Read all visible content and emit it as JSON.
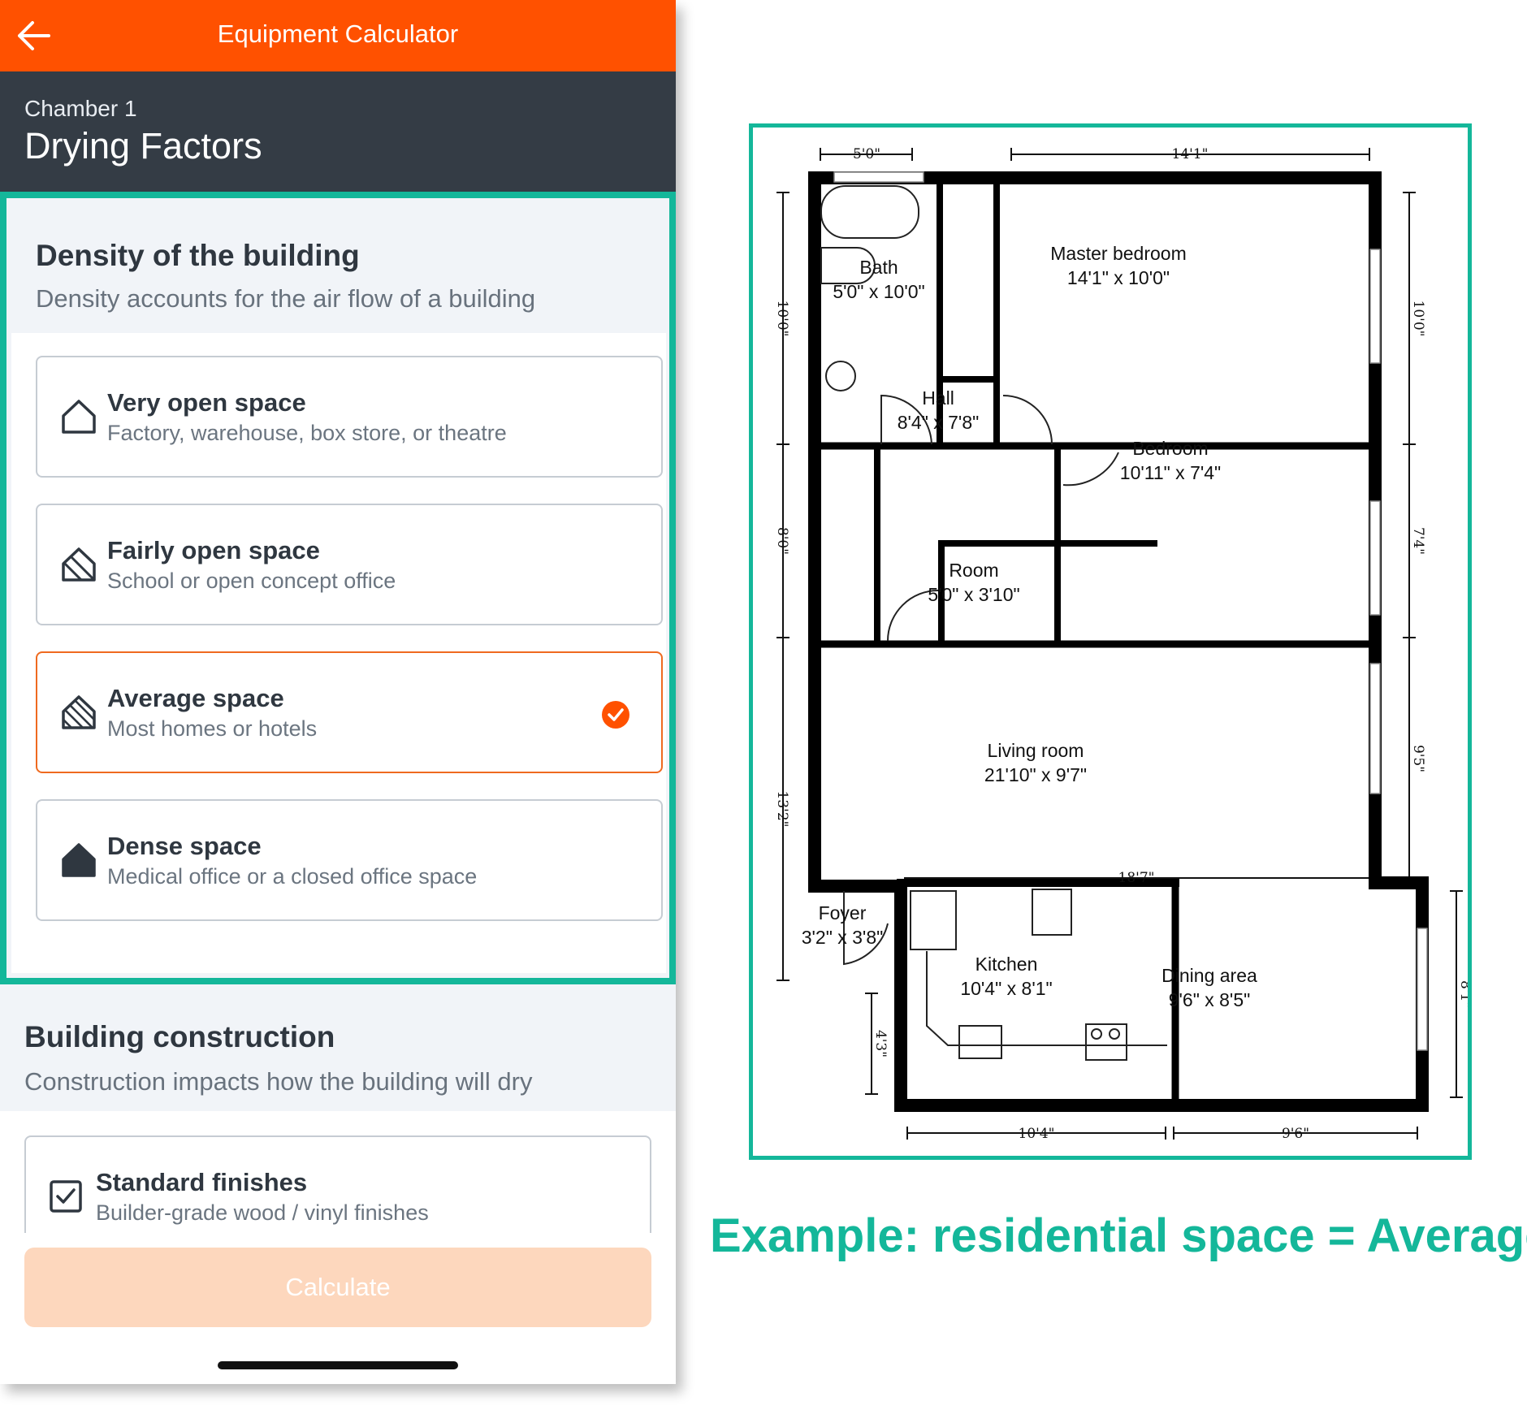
{
  "app": {
    "title": "Equipment Calculator"
  },
  "header": {
    "chamber": "Chamber 1",
    "page_title": "Drying Factors"
  },
  "density": {
    "title": "Density of the building",
    "subtitle": "Density accounts for the air flow of a building",
    "options": [
      {
        "title": "Very open space",
        "subtitle": "Factory, warehouse, box store, or theatre",
        "icon": "house-outline-icon",
        "selected": false
      },
      {
        "title": "Fairly open space",
        "subtitle": "School or open concept office",
        "icon": "house-light-hatch-icon",
        "selected": false
      },
      {
        "title": "Average space",
        "subtitle": "Most homes or hotels",
        "icon": "house-dense-hatch-icon",
        "selected": true
      },
      {
        "title": "Dense space",
        "subtitle": "Medical office or a closed office space",
        "icon": "house-filled-icon",
        "selected": false
      }
    ]
  },
  "construction": {
    "title": "Building construction",
    "subtitle": "Construction impacts how the building will dry",
    "options": [
      {
        "title": "Standard finishes",
        "subtitle": "Builder-grade wood / vinyl finishes",
        "icon": "checkbox-icon"
      }
    ]
  },
  "calculate_button": {
    "label": "Calculate"
  },
  "colors": {
    "accent": "#ff5100",
    "header": "#343c45",
    "highlight": "#14b79a",
    "selected_border": "#ef6a1f",
    "button_disabled": "#fdd7bd"
  },
  "floorplan": {
    "rooms": [
      {
        "name": "Master bedroom",
        "size": "14'1\" x 10'0\""
      },
      {
        "name": "Bath",
        "size": "5'0\" x 10'0\""
      },
      {
        "name": "Hall",
        "size": "8'4\" x 7'8\""
      },
      {
        "name": "Bedroom",
        "size": "10'11\" x 7'4\""
      },
      {
        "name": "Room",
        "size": "5'0\" x 3'10\""
      },
      {
        "name": "Living room",
        "size": "21'10\" x 9'7\""
      },
      {
        "name": "Foyer",
        "size": "3'2\" x 3'8\""
      },
      {
        "name": "Kitchen",
        "size": "10'4\" x 8'1\""
      },
      {
        "name": "Dining area",
        "size": "9'6\" x 8'5\""
      }
    ],
    "dimensions": {
      "top_left": "5'0\"",
      "top_right": "14'1\"",
      "left_upper": "10'0\"",
      "left_middle": "8'0\"",
      "left_lower": "13'2\"",
      "right_upper": "10'0\"",
      "right_middle": "7'4\"",
      "right_lower": "9'5\"",
      "right_bottom": "8'1\"",
      "interior": "18'7\"",
      "foyer": "4'3\"",
      "bottom_left": "10'4\"",
      "bottom_right": "9'6\""
    }
  },
  "caption": "Example: residential space = Average"
}
